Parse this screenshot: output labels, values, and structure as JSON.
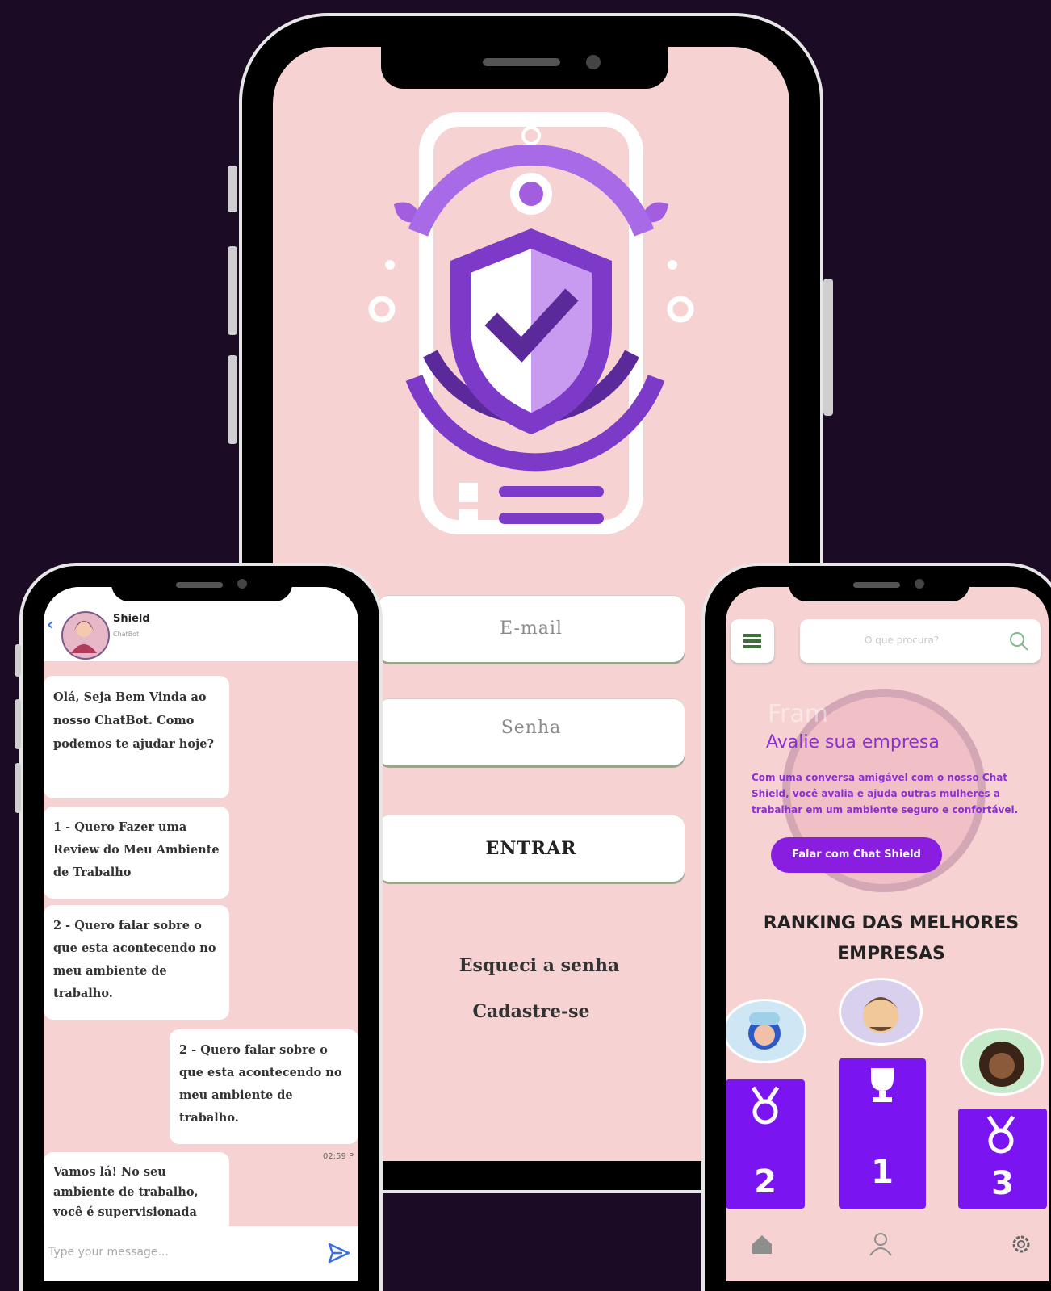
{
  "login": {
    "email_placeholder": "E-mail",
    "password_placeholder": "Senha",
    "enter_label": "ENTRAR",
    "forgot_label": "Esqueci a senha",
    "signup_label": "Cadastre-se"
  },
  "chat": {
    "contact_name": "Shield",
    "contact_status": "ChatBot",
    "messages": [
      {
        "side": "left",
        "text": "Olá, Seja Bem Vinda ao nosso ChatBot. Como podemos te ajudar hoje?"
      },
      {
        "side": "left",
        "text": "1 - Quero Fazer uma Review do Meu Ambiente de Trabalho"
      },
      {
        "side": "left",
        "text": "2 - Quero falar sobre o que esta acontecendo no meu ambiente de trabalho."
      },
      {
        "side": "right",
        "text": "2 - Quero falar sobre o que esta acontecendo no meu ambiente de trabalho."
      },
      {
        "side": "left",
        "text": "Vamos lá! No seu ambiente de trabalho, você é supervisionada"
      }
    ],
    "timestamp": "02:59 P",
    "input_placeholder": "Type your message..."
  },
  "home": {
    "search_placeholder": "O que procura?",
    "hero_faded": "Fram",
    "hero_title": "Avalie sua empresa",
    "hero_text": "Com uma conversa amigável com o nosso Chat Shield, você avalia e ajuda outras mulheres a trabalhar em um ambiente seguro e confortável.",
    "cta_label": "Falar com Chat Shield",
    "ranking_title": "RANKING DAS MELHORES EMPRESAS",
    "podium": [
      {
        "rank": "2"
      },
      {
        "rank": "1"
      },
      {
        "rank": "3"
      }
    ]
  },
  "colors": {
    "background": "#1b0b24",
    "screen": "#f7d2d2",
    "accent": "#7a14f0",
    "hero_purple": "#8e2fd4"
  }
}
